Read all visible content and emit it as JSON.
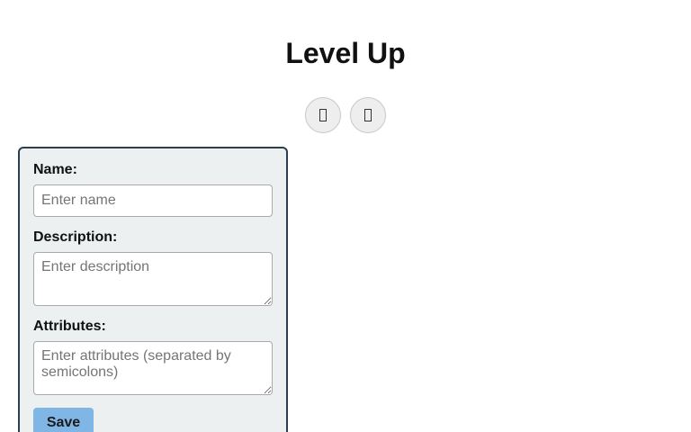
{
  "header": {
    "title": "Level Up"
  },
  "toolbar": {
    "buttons": [
      {
        "icon": "unknown-glyph-icon"
      },
      {
        "icon": "unknown-glyph-icon"
      }
    ]
  },
  "form": {
    "name": {
      "label": "Name:",
      "value": "",
      "placeholder": "Enter name"
    },
    "description": {
      "label": "Description:",
      "value": "",
      "placeholder": "Enter description"
    },
    "attributes": {
      "label": "Attributes:",
      "value": "",
      "placeholder": "Enter attributes (separated by semicolons)"
    },
    "save_label": "Save"
  },
  "colors": {
    "panel_background": "#ecf0f1",
    "panel_border": "#2c3e50",
    "save_button": "#7fb6e6"
  }
}
